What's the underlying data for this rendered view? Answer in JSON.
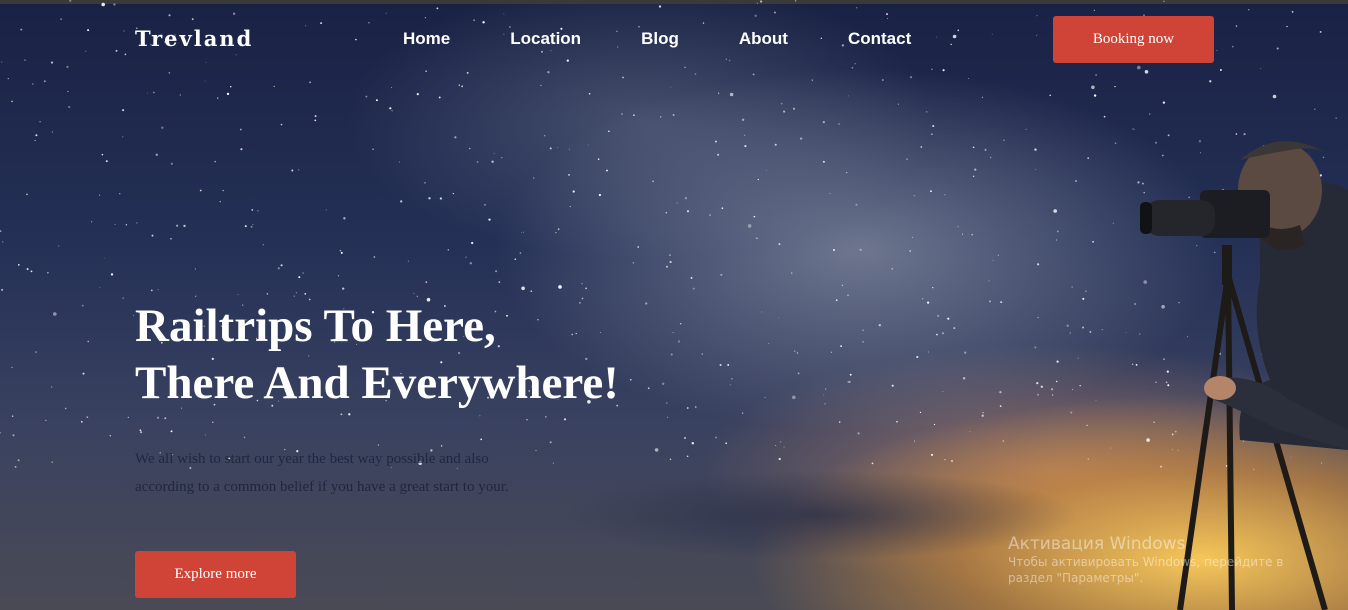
{
  "brand": {
    "logo": "Trevland"
  },
  "nav": {
    "items": [
      {
        "label": "Home"
      },
      {
        "label": "Location"
      },
      {
        "label": "Blog"
      },
      {
        "label": "About"
      },
      {
        "label": "Contact"
      }
    ],
    "cta_label": "Booking now"
  },
  "hero": {
    "headline_line1": "Railtrips To Here,",
    "headline_line2": "There And Everywhere!",
    "description": "We all wish to start our year the best way possible and also according to a common belief if you have a great start to your.",
    "button_label": "Explore more"
  },
  "os_watermark": {
    "title": "Активация Windows",
    "subtitle": "Чтобы активировать Windows, перейдите в раздел \"Параметры\"."
  },
  "colors": {
    "accent": "#cf4437",
    "sky_dark": "#1a2244",
    "sunset": "#ffcd5a"
  }
}
